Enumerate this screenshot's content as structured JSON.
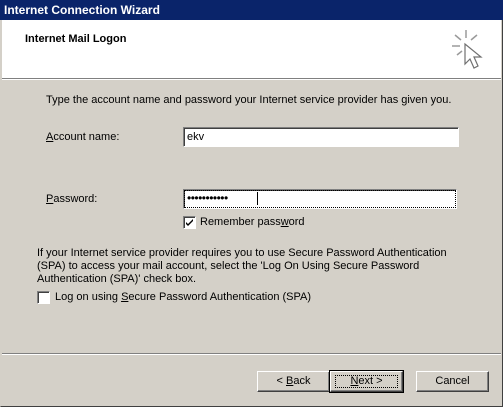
{
  "window": {
    "title": "Internet Connection Wizard"
  },
  "header": {
    "title": "Internet Mail Logon",
    "icon": "wizard-wand-icon"
  },
  "form": {
    "intro": "Type the account name and password your Internet service provider has given you.",
    "account_label_pre": "",
    "account_label_key": "A",
    "account_label_post": "ccount name:",
    "account_value": "ekv",
    "password_label_pre": "",
    "password_label_key": "P",
    "password_label_post": "assword:",
    "password_value": "•••••••••••",
    "remember_pre": "Remember pass",
    "remember_key": "w",
    "remember_post": "ord",
    "remember_checked": true,
    "spa_text_line1": "If your Internet service provider requires you to use Secure Password Authentication",
    "spa_text_line2": "(SPA) to access your mail account, select the 'Log On Using Secure Password",
    "spa_text_line3": "Authentication (SPA)' check box.",
    "spa_check_pre": "Log on using ",
    "spa_check_key": "S",
    "spa_check_post": "ecure Password Authentication (SPA)",
    "spa_checked": false
  },
  "buttons": {
    "back_pre": "< ",
    "back_key": "B",
    "back_post": "ack",
    "next_key": "N",
    "next_post": "ext >",
    "cancel": "Cancel"
  }
}
